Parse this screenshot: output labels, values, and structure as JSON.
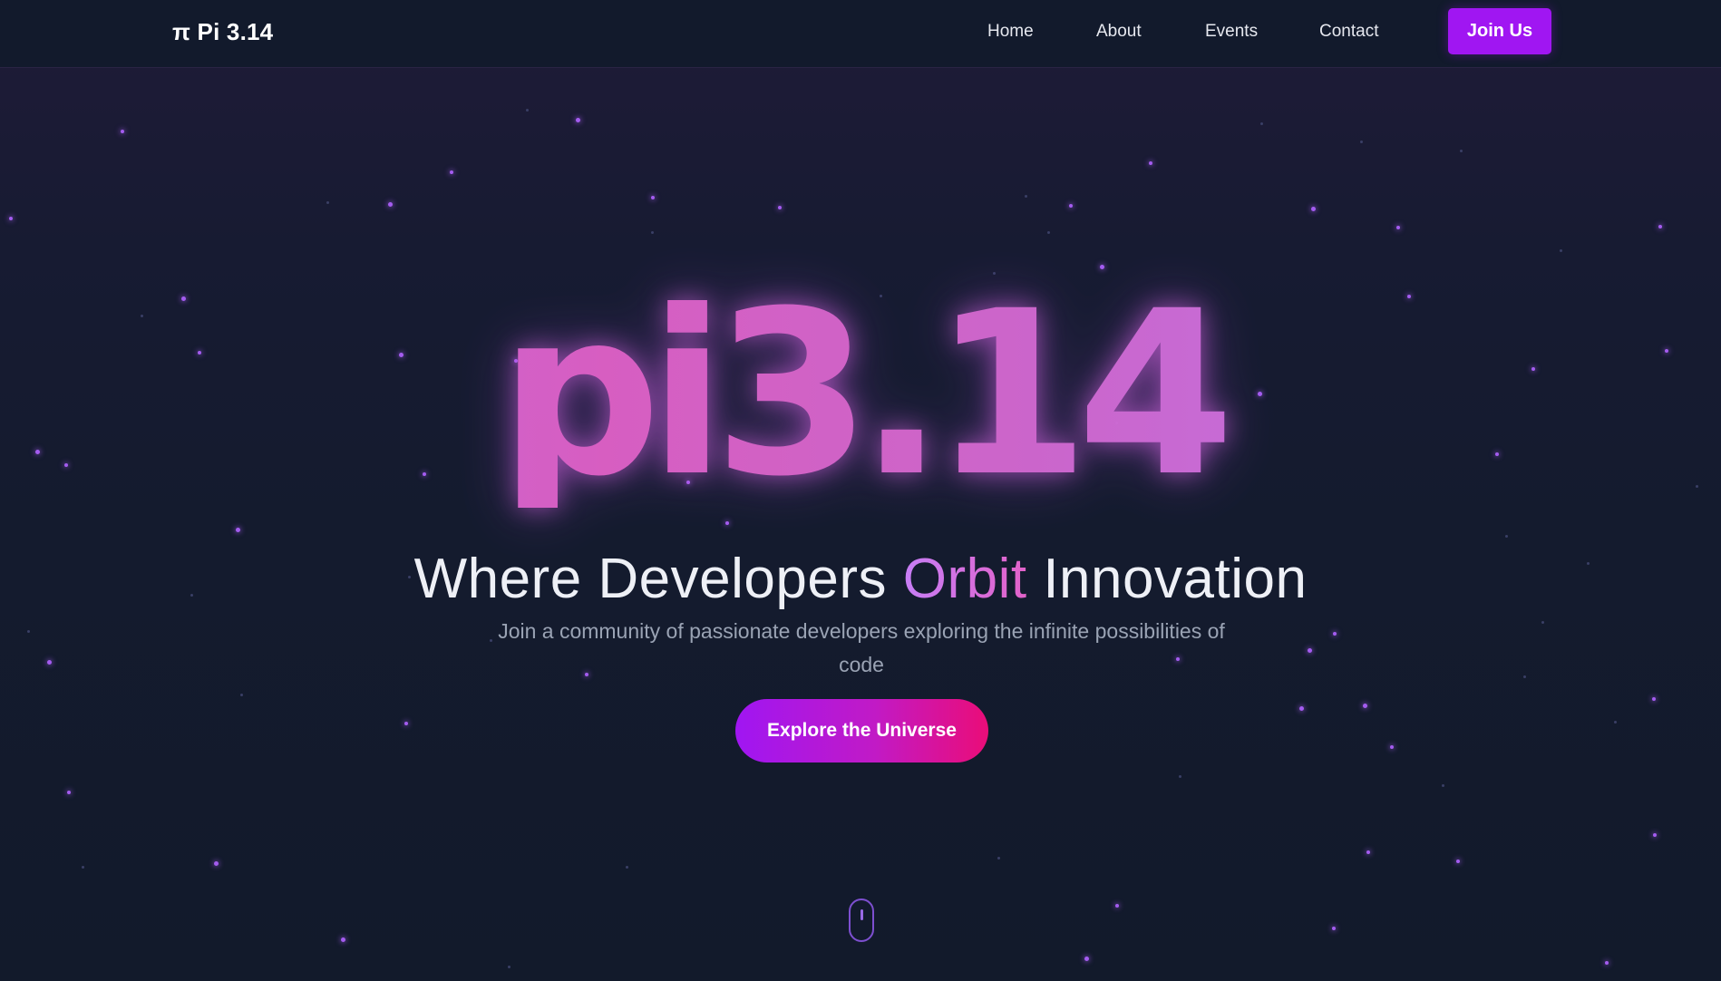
{
  "nav": {
    "brand": "π Pi 3.14",
    "links": [
      {
        "label": "Home"
      },
      {
        "label": "About"
      },
      {
        "label": "Events"
      },
      {
        "label": "Contact"
      }
    ],
    "join_label": "Join Us"
  },
  "hero": {
    "logo_text": "pi3.14",
    "tagline_before": "Where Developers ",
    "tagline_accent": "Orbit",
    "tagline_after": " Innovation",
    "subtitle": "Join a community of passionate developers exploring the infinite possibilities of code",
    "cta_label": "Explore the Universe",
    "scroll_icon": "mouse-scroll-icon"
  },
  "colors": {
    "background": "#121a2c",
    "accent_purple": "#a016f2",
    "accent_pink": "#ea0d78",
    "glow": "#d566e0"
  }
}
